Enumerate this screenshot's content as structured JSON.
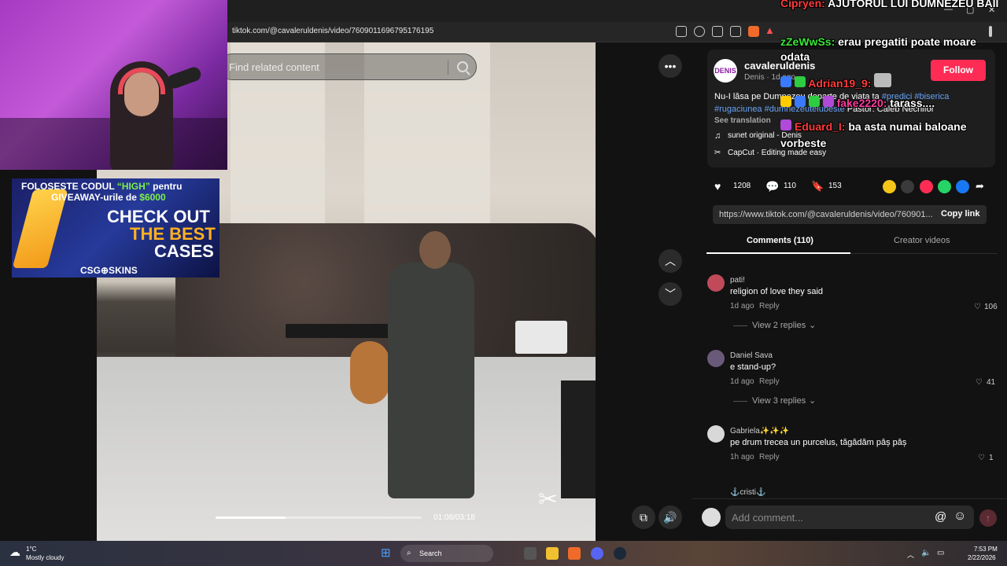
{
  "browser": {
    "url": "tiktok.com/@cavaleruldenis/video/7609011696795176195"
  },
  "video": {
    "search_placeholder": "Find related content",
    "time": "01:08/03:18",
    "progress": 0.34
  },
  "author": {
    "avatar_text": "DENIS",
    "username": "cavaleruldenis",
    "meta": "Denis · 1d ago",
    "follow_label": "Follow"
  },
  "description": {
    "line1_text": "Nu-I lăsa pe Dumnezeu departe de viata ta ",
    "line1_tags": "#predici #biserica",
    "line2_tags": "#rugaciunea #dumnezeutelubeste",
    "line2_text": " Pastor: Caleb Nechifor",
    "see_translation": "See translation",
    "sound_icon": "music-note",
    "sound": "sunet original - Denis",
    "capcut": "CapCut · Editing made easy"
  },
  "stats": {
    "likes": "1208",
    "comments": "110",
    "saves": "153"
  },
  "share": {
    "link": "https://www.tiktok.com/@cavaleruldenis/video/760901...",
    "copy_label": "Copy link",
    "colors": [
      "#f5c518",
      "#3a3a3a",
      "#fe2c55",
      "#25d366",
      "#1877f2"
    ]
  },
  "tabs": [
    {
      "label": "Comments (110)"
    },
    {
      "label": "Creator videos"
    }
  ],
  "comments": [
    {
      "user": "pati!",
      "text": "religion of love they said",
      "time": "1d ago",
      "reply": "Reply",
      "likes": "106",
      "view_replies": "View 2 replies"
    },
    {
      "user": "Daniel Sava",
      "text": "e stand-up?",
      "time": "1d ago",
      "reply": "Reply",
      "likes": "41",
      "view_replies": "View 3 replies"
    },
    {
      "user": "Gabriela✨✨✨",
      "text": "pe drum trecea un purcelus, tăgâdăm pâș pâș",
      "time": "1h ago",
      "reply": "Reply",
      "likes": "1"
    },
    {
      "user": "⚓cristi⚓"
    }
  ],
  "comment_input": {
    "placeholder": "Add comment..."
  },
  "ad": {
    "line1a": "FOLOSESTE CODUL ",
    "line1b": "“HIGH”",
    "line1c": " pentru",
    "line2a": "GIVEAWAY-urile de ",
    "line2b": "$6000",
    "check": "CHECK OUT",
    "best": "THE BEST",
    "cases": "CASES",
    "brand": "CSG⊕SKINS"
  },
  "chat": [
    {
      "user": "Cipryen:",
      "msg": " AJUTORUL LUI DUMNEZEU BAII",
      "color": "#ff3b3b"
    },
    {
      "user": "zZeWwSs:",
      "msg": " erau pregatiti poate moare odata",
      "color": "#39e639"
    },
    {
      "user": "Adrian19_9:",
      "msg": "",
      "color": "#ff3b3b"
    },
    {
      "user": "fake2220:",
      "msg": " tarass....",
      "color": "#ff3b9e"
    },
    {
      "user": "Eduard_I:",
      "msg": " ba asta numai baloane vorbeste",
      "color": "#ff3b3b"
    }
  ],
  "taskbar": {
    "temp": "1°C",
    "weather": "Mostly cloudy",
    "search": "Search",
    "time": "7:53 PM",
    "date": "2/22/2026"
  }
}
